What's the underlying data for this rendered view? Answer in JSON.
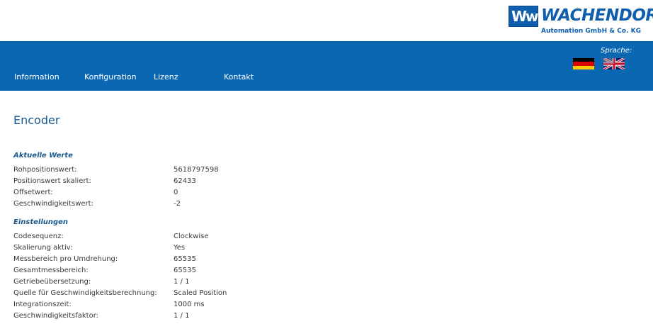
{
  "logo": {
    "name": "WACHENDORFF",
    "subtitle": "Automation GmbH & Co. KG",
    "colors": {
      "brand": "#0f5fae"
    }
  },
  "nav": {
    "items": [
      {
        "label": "Information"
      },
      {
        "label": "Konfiguration"
      },
      {
        "label": "Lizenz"
      },
      {
        "label": "Kontakt"
      }
    ],
    "language_label": "Sprache:",
    "languages": [
      "german-flag-icon",
      "english-flag-icon"
    ],
    "background": "#0b67b2"
  },
  "page": {
    "title": "Encoder"
  },
  "aktuelle_werte": {
    "title": "Aktuelle Werte",
    "rows": [
      {
        "label": "Rohpositionswert:",
        "value": "5618797598"
      },
      {
        "label": "Positionswert skaliert:",
        "value": "62433"
      },
      {
        "label": "Offsetwert:",
        "value": "0"
      },
      {
        "label": "Geschwindigkeitswert:",
        "value": "-2"
      }
    ]
  },
  "einstellungen": {
    "title": "Einstellungen",
    "rows": [
      {
        "label": "Codesequenz:",
        "value": "Clockwise"
      },
      {
        "label": "Skalierung aktiv:",
        "value": "Yes"
      },
      {
        "label": "Messbereich pro Umdrehung:",
        "value": "65535"
      },
      {
        "label": "Gesamtmessbereich:",
        "value": "65535"
      },
      {
        "label": "Getriebeübersetzung:",
        "value": "1 / 1"
      },
      {
        "label": "Quelle für Geschwindigkeitsberechnung:",
        "value": "Scaled Position"
      },
      {
        "label": "Integrationszeit:",
        "value": "1000 ms"
      },
      {
        "label": "Geschwindigkeitsfaktor:",
        "value": "1 / 1"
      }
    ]
  }
}
